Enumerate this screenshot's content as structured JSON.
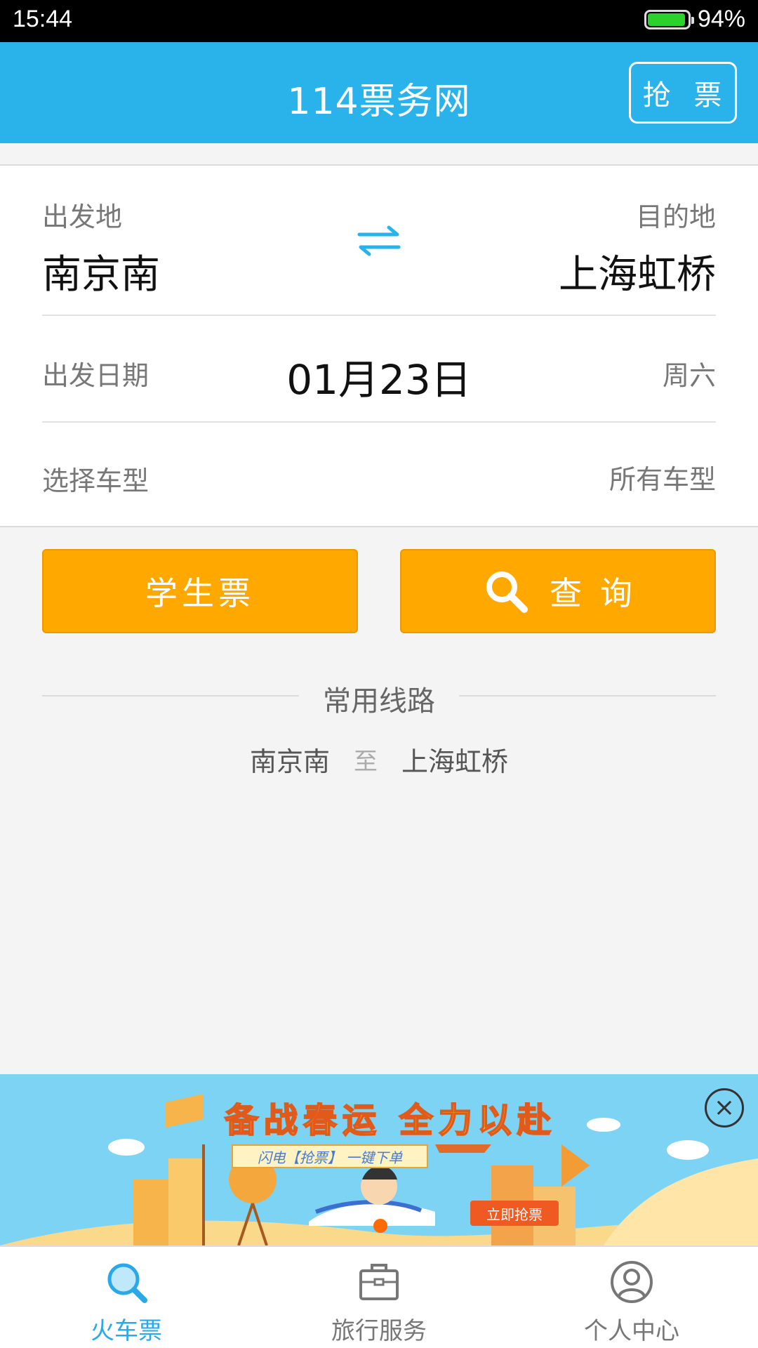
{
  "status_bar": {
    "time": "15:44",
    "battery": "94%",
    "battery_level": 0.94
  },
  "header": {
    "title": "114票务网",
    "grab_button": "抢 票"
  },
  "form": {
    "from_label": "出发地",
    "from_city": "南京南",
    "to_label": "目的地",
    "to_city": "上海虹桥",
    "date_label": "出发日期",
    "date_value": "01月23日",
    "weekday": "周六",
    "type_label": "选择车型",
    "type_value": "所有车型"
  },
  "actions": {
    "student_ticket": "学生票",
    "search": "查询"
  },
  "common_routes": {
    "title": "常用线路",
    "routes": [
      {
        "from": "南京南",
        "to_word": "至",
        "to": "上海虹桥"
      }
    ]
  },
  "banner": {
    "headline": "备战春运 全力以赴",
    "strip_text": "闪电【抢票】 一键下单",
    "cta": "立即抢票",
    "close_symbol": "×"
  },
  "tab_bar": {
    "items": [
      {
        "label": "火车票",
        "icon": "search-icon",
        "active": true
      },
      {
        "label": "旅行服务",
        "icon": "briefcase-icon",
        "active": false
      },
      {
        "label": "个人中心",
        "icon": "user-icon",
        "active": false
      }
    ]
  },
  "colors": {
    "primary": "#29b3ea",
    "accent": "#ffa800",
    "tab_active": "#29a9e6"
  }
}
